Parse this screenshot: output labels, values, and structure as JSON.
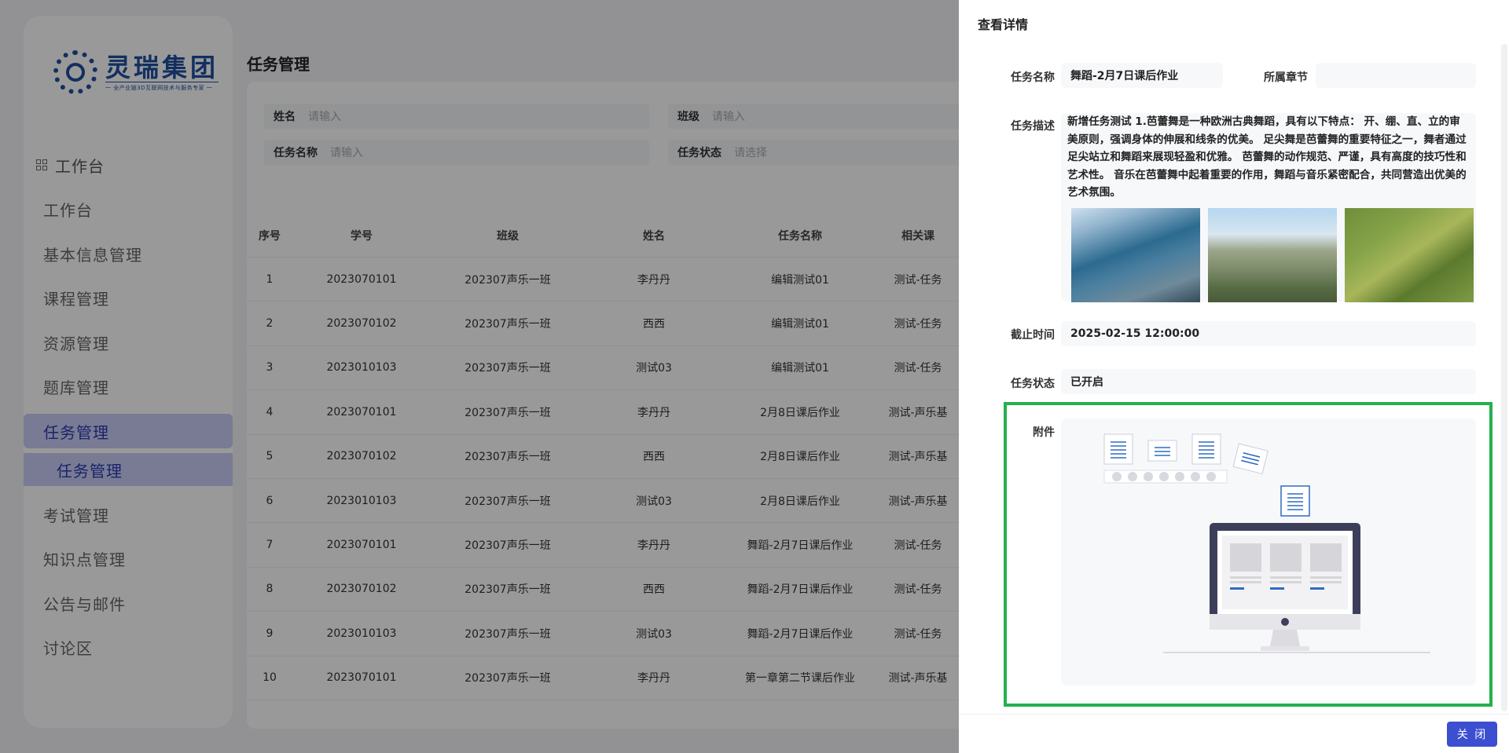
{
  "sidebar": {
    "logo_name": "灵瑞集团",
    "logo_sub": "一 全产业链3D互联网技术与服务专家 一",
    "items": [
      {
        "label": "工作台"
      },
      {
        "label": "工作台"
      },
      {
        "label": "基本信息管理"
      },
      {
        "label": "课程管理"
      },
      {
        "label": "资源管理"
      },
      {
        "label": "题库管理"
      },
      {
        "label": "任务管理"
      },
      {
        "label": "任务管理"
      },
      {
        "label": "考试管理"
      },
      {
        "label": "知识点管理"
      },
      {
        "label": "公告与邮件"
      },
      {
        "label": "讨论区"
      }
    ]
  },
  "page": {
    "title": "任务管理"
  },
  "filters": {
    "name_label": "姓名",
    "name_placeholder": "请输入",
    "class_label": "班级",
    "class_placeholder": "请输入",
    "task_label": "任务名称",
    "task_placeholder": "请输入",
    "status_label": "任务状态",
    "status_placeholder": "请选择"
  },
  "table": {
    "headers": [
      "序号",
      "学号",
      "班级",
      "姓名",
      "任务名称",
      "相关课"
    ],
    "rows": [
      [
        "1",
        "2023070101",
        "202307声乐一班",
        "李丹丹",
        "编辑测试01",
        "测试-任务"
      ],
      [
        "2",
        "2023070102",
        "202307声乐一班",
        "西西",
        "编辑测试01",
        "测试-任务"
      ],
      [
        "3",
        "2023010103",
        "202307声乐一班",
        "测试03",
        "编辑测试01",
        "测试-任务"
      ],
      [
        "4",
        "2023070101",
        "202307声乐一班",
        "李丹丹",
        "2月8日课后作业",
        "测试-声乐基"
      ],
      [
        "5",
        "2023070102",
        "202307声乐一班",
        "西西",
        "2月8日课后作业",
        "测试-声乐基"
      ],
      [
        "6",
        "2023010103",
        "202307声乐一班",
        "测试03",
        "2月8日课后作业",
        "测试-声乐基"
      ],
      [
        "7",
        "2023070101",
        "202307声乐一班",
        "李丹丹",
        "舞蹈-2月7日课后作业",
        "测试-任务"
      ],
      [
        "8",
        "2023070102",
        "202307声乐一班",
        "西西",
        "舞蹈-2月7日课后作业",
        "测试-任务"
      ],
      [
        "9",
        "2023010103",
        "202307声乐一班",
        "测试03",
        "舞蹈-2月7日课后作业",
        "测试-任务"
      ],
      [
        "10",
        "2023070101",
        "202307声乐一班",
        "李丹丹",
        "第一章第二节课后作业",
        "测试-声乐基"
      ]
    ]
  },
  "drawer": {
    "title": "查看详情",
    "task_name_label": "任务名称",
    "task_name_value": "舞蹈-2月7日课后作业",
    "chapter_label": "所属章节",
    "chapter_value": "",
    "desc_label": "任务描述",
    "desc_value": "新增任务测试 1.芭蕾舞是一种欧洲古典舞蹈，具有以下特点： 开、绷、直、立的审美原则，强调身体的伸展和线条的优美。 足尖舞是芭蕾舞的重要特征之一，舞者通过足尖站立和舞蹈来展现轻盈和优雅。 芭蕾舞的动作规范、严谨，具有高度的技巧性和艺术性。 音乐在芭蕾舞中起着重要的作用，舞蹈与音乐紧密配合，共同营造出优美的艺术氛围。",
    "deadline_label": "截止时间",
    "deadline_value": "2025-02-15 12:00:00",
    "status_label": "任务状态",
    "status_value": "已开启",
    "attachment_label": "附件",
    "close_label": "关 闭",
    "highlight_color": "#23b14d",
    "primary_color": "#3b4fd0"
  }
}
